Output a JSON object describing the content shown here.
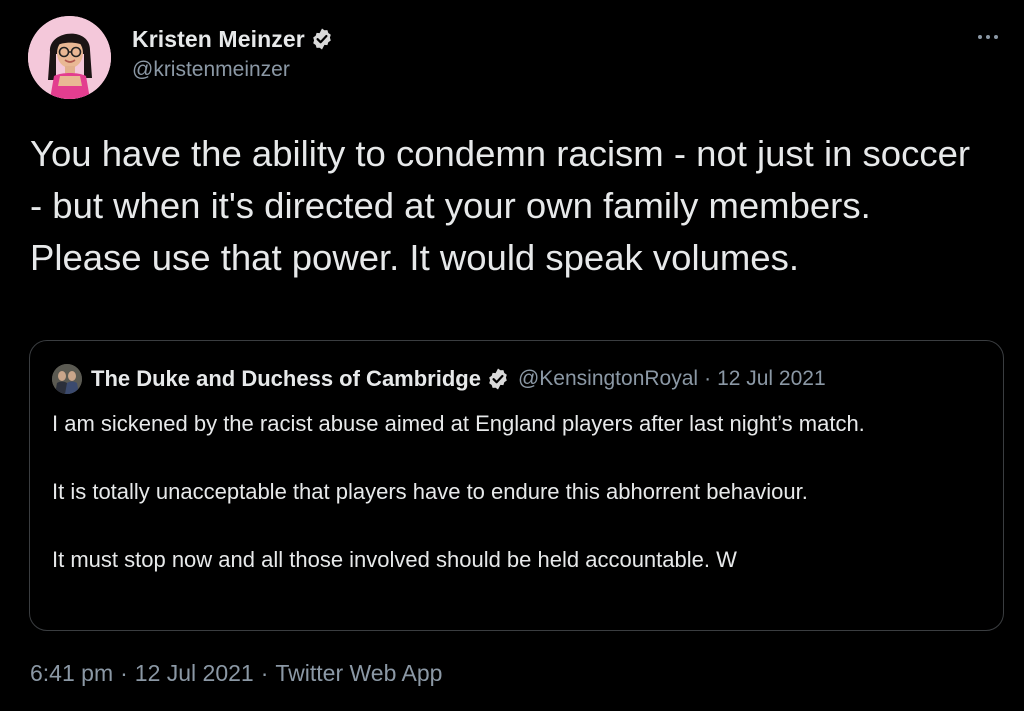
{
  "tweet": {
    "author": {
      "display_name": "Kristen Meinzer",
      "handle": "@kristenmeinzer",
      "avatar_icon": "avatar-kristen",
      "verified": true
    },
    "text": "You have the ability to condemn racism - not just in soccer - but when it's directed at your own family members. Please use that power. It would speak volumes.",
    "quote": {
      "display_name": "The Duke and Duchess of Cambridge",
      "handle": "@KensingtonRoyal",
      "separator": "·",
      "date": "12 Jul 2021",
      "verified": true,
      "text": "I am sickened by the racist abuse aimed at England players after last night’s match.\n\nIt is totally unacceptable that players have to endure this abhorrent behaviour.\n\nIt must stop now and all those involved should be held accountable. W"
    },
    "meta": {
      "time": "6:41 pm",
      "separator": "·",
      "date": "12 Jul 2021",
      "source": "Twitter Web App"
    }
  },
  "colors": {
    "background": "#000000",
    "text_primary": "#e7e9ea",
    "text_secondary": "#8b98a5",
    "border": "#3a3d40",
    "verified_badge": "#d9d9d9"
  },
  "icons": {
    "verified": "verified-badge-icon",
    "more": "more-options-icon"
  }
}
